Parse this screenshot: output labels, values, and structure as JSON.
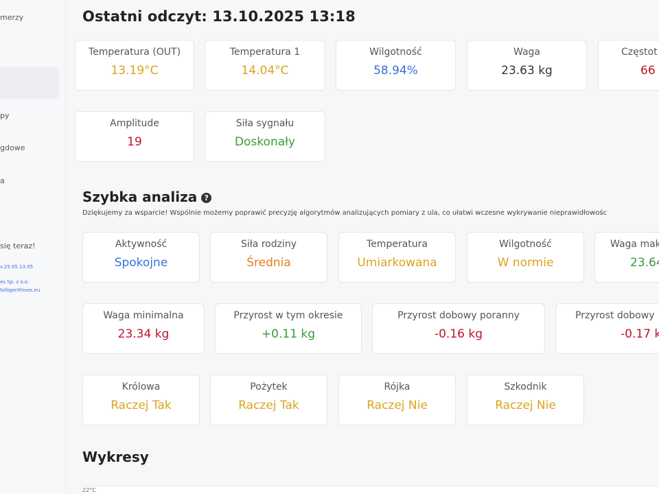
{
  "sidebar": {
    "item_1": "merzy",
    "item_2": "py",
    "item_3": "gdowe",
    "item_4": "a",
    "promo": "się teraz!",
    "version": "v.25.05.13.05",
    "company": "es Sp. z o.o.",
    "site": "telligenthives.eu"
  },
  "header": {
    "title": "Ostatni odczyt: 13.10.2025 13:18"
  },
  "readings": [
    {
      "label": "Temperatura (OUT)",
      "value": "13.19°C",
      "color": "#d9a31c"
    },
    {
      "label": "Temperatura 1",
      "value": "14.04°C",
      "color": "#d9a31c"
    },
    {
      "label": "Wilgotność",
      "value": "58.94%",
      "color": "#3b6fd6"
    },
    {
      "label": "Waga",
      "value": "23.63 kg",
      "color": "#333333"
    },
    {
      "label": "Częstot",
      "value": "66",
      "color": "#c0132b"
    },
    {
      "label": "Amplitude",
      "value": "19",
      "color": "#c0132b"
    },
    {
      "label": "Siła sygnału",
      "value": "Doskonały",
      "color": "#3a9a3a"
    }
  ],
  "analysis": {
    "title": "Szybka analiza",
    "help_icon": "question-circle-icon",
    "note": "Dziękujemy za wsparcie! Wspólnie możemy poprawić precyzję algorytmów analizujących pomiary z ula, co ułatwi wczesne wykrywanie nieprawidłowośc",
    "row1": [
      {
        "label": "Aktywność",
        "value": "Spokojne",
        "color": "#3b6fd6"
      },
      {
        "label": "Siła rodziny",
        "value": "Średnia",
        "color": "#e37f1e"
      },
      {
        "label": "Temperatura",
        "value": "Umiarkowana",
        "color": "#d9a31c"
      },
      {
        "label": "Wilgotność",
        "value": "W normie",
        "color": "#d9a31c"
      },
      {
        "label": "Waga mak",
        "value": "23.64",
        "color": "#3a9a3a"
      }
    ],
    "row2": [
      {
        "label": "Waga minimalna",
        "value": "23.34 kg",
        "color": "#c0132b"
      },
      {
        "label": "Przyrost w tym okresie",
        "value": "+0.11 kg",
        "color": "#3a9a3a"
      },
      {
        "label": "Przyrost dobowy poranny",
        "value": "-0.16 kg",
        "color": "#c0132b"
      },
      {
        "label": "Przyrost dobowy",
        "value": "-0.17 k",
        "color": "#c0132b"
      }
    ],
    "row3": [
      {
        "label": "Królowa",
        "value": "Raczej Tak",
        "color": "#d9a31c"
      },
      {
        "label": "Pożytek",
        "value": "Raczej Tak",
        "color": "#d9a31c"
      },
      {
        "label": "Rójka",
        "value": "Raczej Nie",
        "color": "#d9a31c"
      },
      {
        "label": "Szkodnik",
        "value": "Raczej Nie",
        "color": "#d9a31c"
      }
    ]
  },
  "charts": {
    "title": "Wykresy",
    "axis_top": "22°C"
  }
}
